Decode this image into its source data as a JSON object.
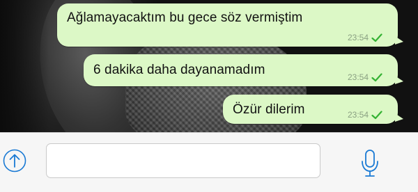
{
  "colors": {
    "bubble": "#dcf8c6",
    "check": "#34b233",
    "accent": "#1a7ad4",
    "input_bar": "#f6f6f6"
  },
  "messages": [
    {
      "text": "Ağlamayacaktım bu gece söz vermiştim",
      "time": "23:54",
      "status": "delivered"
    },
    {
      "text": "6 dakika daha dayanamadım",
      "time": "23:54",
      "status": "delivered"
    },
    {
      "text": "Özür dilerim",
      "time": "23:54",
      "status": "delivered"
    }
  ],
  "composer": {
    "input_value": "",
    "input_placeholder": "",
    "attach_icon": "upload-arrow-circle-icon",
    "mic_icon": "microphone-icon"
  }
}
